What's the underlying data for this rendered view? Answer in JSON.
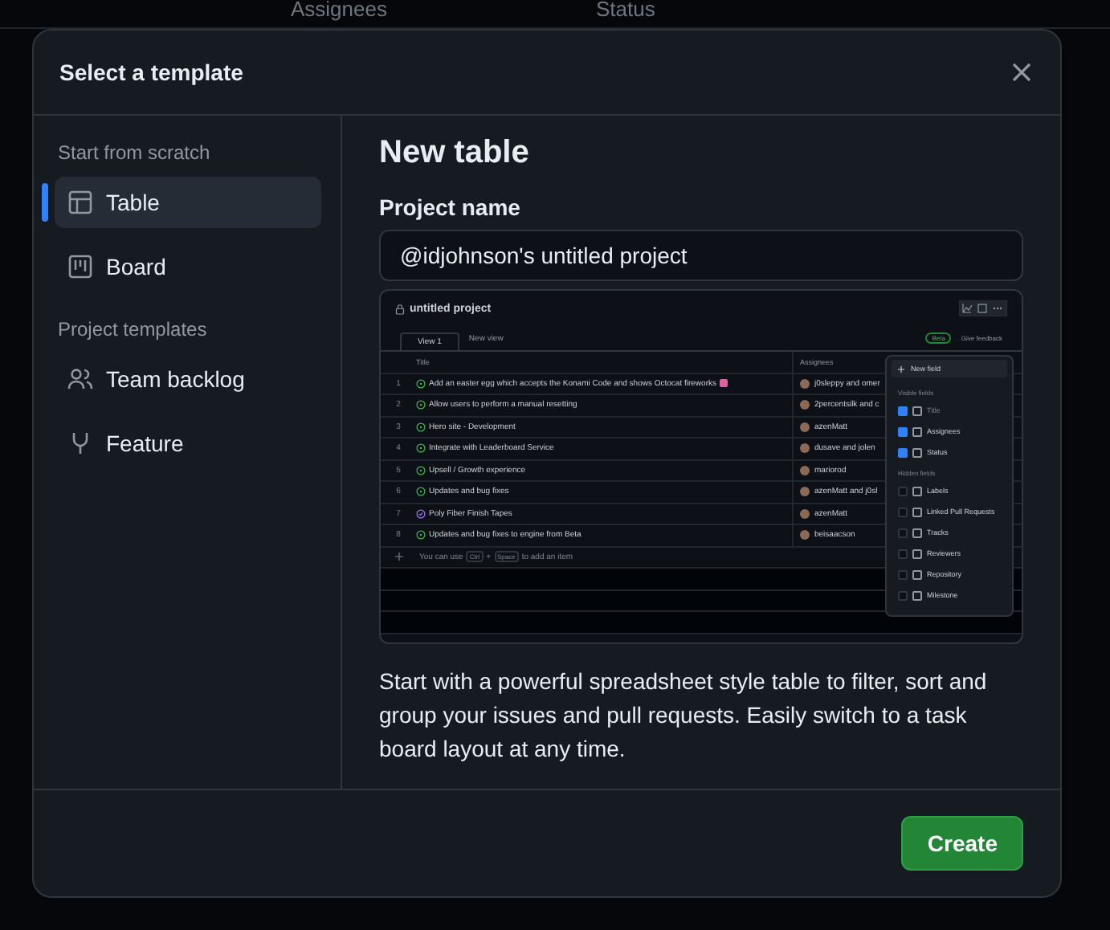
{
  "background_table": {
    "columns": [
      "Assignees",
      "Status"
    ]
  },
  "dialog": {
    "title": "Select a template"
  },
  "sidebar": {
    "sections": [
      {
        "heading": "Start from scratch",
        "items": [
          {
            "label": "Table",
            "selected": true
          },
          {
            "label": "Board",
            "selected": false
          }
        ]
      },
      {
        "heading": "Project templates",
        "items": [
          {
            "label": "Team backlog",
            "selected": false
          },
          {
            "label": "Feature",
            "selected": false
          }
        ]
      }
    ]
  },
  "main": {
    "heading": "New table",
    "project_name_label": "Project name",
    "project_name_value": "@idjohnson's untitled project",
    "preview": {
      "title": "untitled project",
      "view_tab": "View 1",
      "new_view": "New view",
      "beta_badge": "Beta",
      "feedback": "Give feedback",
      "columns": [
        "Title",
        "Assignees"
      ],
      "rows": [
        {
          "number": "1",
          "title": "Add an easter egg which accepts the Konami Code and shows Octocat fireworks",
          "done": false,
          "emoji": true,
          "assignee": "j0sleppy and omer"
        },
        {
          "number": "2",
          "title": "Allow users to perform a manual resetting",
          "done": false,
          "emoji": false,
          "assignee": "2percentsilk and c"
        },
        {
          "number": "3",
          "title": "Hero site - Development",
          "done": false,
          "emoji": false,
          "assignee": "azenMatt"
        },
        {
          "number": "4",
          "title": "Integrate with Leaderboard Service",
          "done": false,
          "emoji": false,
          "assignee": "dusave and jolen"
        },
        {
          "number": "5",
          "title": "Upsell / Growth experience",
          "done": false,
          "emoji": false,
          "assignee": "mariorod"
        },
        {
          "number": "6",
          "title": "Updates and bug fixes",
          "done": false,
          "emoji": false,
          "assignee": "azenMatt and j0sl"
        },
        {
          "number": "7",
          "title": "Poly Fiber Finish Tapes",
          "done": true,
          "emoji": false,
          "assignee": "azenMatt"
        },
        {
          "number": "8",
          "title": "Updates and bug fixes to engine from Beta",
          "done": false,
          "emoji": false,
          "assignee": "beisaacson"
        }
      ],
      "add_hint": {
        "before": "You can use",
        "key_1": "Ctrl",
        "plus": "+",
        "key_2": "Space",
        "after": "to add an item"
      },
      "menu": {
        "new_field": "New field",
        "visible_heading": "Visible fields",
        "visible": [
          {
            "label": "Title",
            "checked": true,
            "disabled": true
          },
          {
            "label": "Assignees",
            "checked": true,
            "disabled": false
          },
          {
            "label": "Status",
            "checked": true,
            "disabled": false
          }
        ],
        "hidden_heading": "Hidden fields",
        "hidden": [
          {
            "label": "Labels",
            "checked": false,
            "disabled": false
          },
          {
            "label": "Linked Pull Requests",
            "checked": false,
            "disabled": false
          },
          {
            "label": "Tracks",
            "checked": false,
            "disabled": false
          },
          {
            "label": "Reviewers",
            "checked": false,
            "disabled": false
          },
          {
            "label": "Repository",
            "checked": false,
            "disabled": false
          },
          {
            "label": "Milestone",
            "checked": false,
            "disabled": false
          }
        ]
      }
    },
    "description": "Start with a powerful spreadsheet style table to filter, sort and group your issues and pull requests. Easily switch to a task board layout at any time."
  },
  "footer": {
    "create_button": "Create"
  }
}
